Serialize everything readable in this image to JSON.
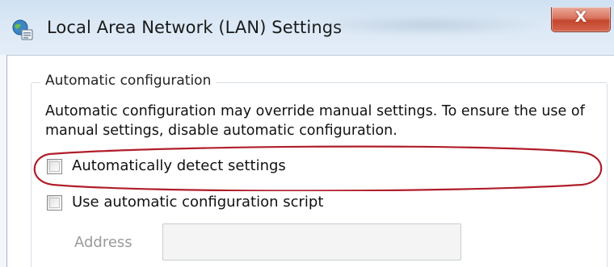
{
  "window": {
    "title": "Local Area Network (LAN) Settings",
    "close_glyph": "X"
  },
  "icons": {
    "app": "network-settings-icon",
    "close": "close-icon"
  },
  "auto_config": {
    "group_title": "Automatic configuration",
    "description": "Automatic configuration may override manual settings.  To ensure the use of manual settings, disable automatic configuration.",
    "detect_label": "Automatically detect settings",
    "detect_checked": false,
    "script_label": "Use automatic configuration script",
    "script_checked": false,
    "address_label": "Address",
    "address_value": ""
  },
  "annotation": {
    "highlight_color": "#b01e2a"
  }
}
